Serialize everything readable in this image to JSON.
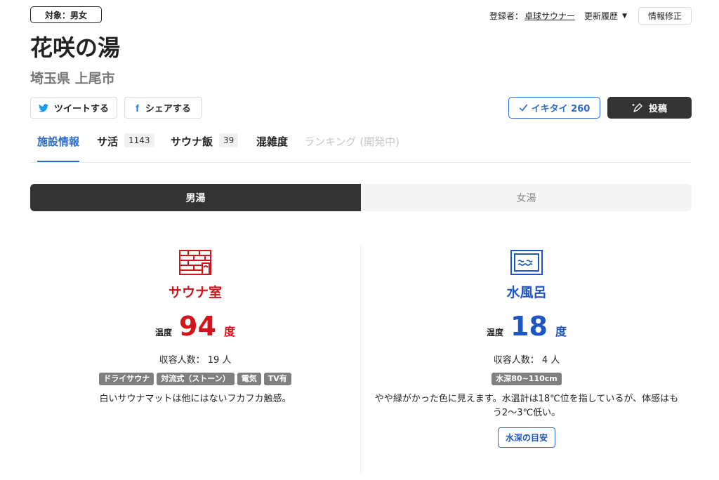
{
  "header": {
    "target_badge": "対象：男女",
    "registrant_label": "登録者：",
    "registrant_name": "卓球サウナー",
    "history_label": "更新履歴",
    "edit_label": "情報修正"
  },
  "facility": {
    "name": "花咲の湯",
    "location": "埼玉県 上尾市"
  },
  "share": {
    "tweet_label": "ツイートする",
    "facebook_label": "シェアする"
  },
  "actions": {
    "ikitai_label": "イキタイ 260",
    "post_label": "投稿"
  },
  "tabs": [
    {
      "label": "施設情報",
      "count": null,
      "active": true
    },
    {
      "label": "サ活",
      "count": "1143"
    },
    {
      "label": "サウナ飯",
      "count": "39"
    },
    {
      "label": "混雑度",
      "count": null
    },
    {
      "label": "ランキング (開発中)",
      "count": null,
      "disabled": true
    }
  ],
  "gender_toggle": {
    "male": "男湯",
    "female": "女湯",
    "selected": "男湯"
  },
  "sauna": {
    "icon": "sauna-room-icon",
    "title": "サウナ室",
    "temp_label": "温度",
    "temp_value": "94",
    "temp_unit": "度",
    "capacity": "収容人数： 19 人",
    "tags": [
      "ドライサウナ",
      "対流式（ストーン）",
      "電気",
      "TV有"
    ],
    "description": "白いサウナマットは他にはないフカフカ触感。",
    "color": "#d4141b"
  },
  "water": {
    "icon": "water-bath-icon",
    "title": "水風呂",
    "temp_label": "温度",
    "temp_value": "18",
    "temp_unit": "度",
    "capacity": "収容人数： 4 人",
    "tags": [
      "水深80~110cm"
    ],
    "description": "やや緑がかった色に見えます。水温計は18℃位を指しているが、体感はもう2〜3℃低い。",
    "guide_label": "水深の目安",
    "color": "#1f55c0"
  }
}
